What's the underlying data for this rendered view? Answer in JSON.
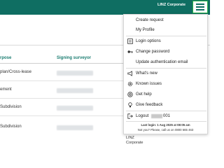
{
  "header": {
    "corp_name": "LINZ Corporate",
    "menu_button_icon": "hamburger-icon",
    "brand_color": "#0f6e62",
    "focus_color": "#29b34a"
  },
  "table": {
    "columns": [
      "rpose",
      "Signing surveyor"
    ],
    "rows": [
      {
        "purpose": "plan/Cross-lease"
      },
      {
        "purpose": "ement"
      },
      {
        "purpose": "Subdivision"
      },
      {
        "purpose": "Subdivision"
      }
    ]
  },
  "background_text": {
    "linz_1": "LINZ",
    "corporate_1": "Corporate"
  },
  "user_menu": {
    "items": [
      {
        "label": "Create request",
        "icon": ""
      },
      {
        "label": "My Profile",
        "icon": ""
      },
      {
        "label": "Login options",
        "icon": "login-options-icon"
      },
      {
        "label": "Change password",
        "icon": "key-icon"
      },
      {
        "label": "Update authentication email",
        "icon": ""
      },
      {
        "label": "What's new",
        "icon": "megaphone-icon"
      },
      {
        "label": "Known issues",
        "icon": "gear-icon"
      },
      {
        "label": "Get help",
        "icon": "help-icon"
      },
      {
        "label": "Give feedback",
        "icon": "lightbulb-icon"
      }
    ],
    "logout": {
      "label": "Logout",
      "suffix": "001",
      "icon": "logout-icon"
    },
    "last_login": "Last login: 1 Aug 2025 at 08:05 am",
    "not_you": "Not you? Please, call us on 0800 665 463"
  }
}
